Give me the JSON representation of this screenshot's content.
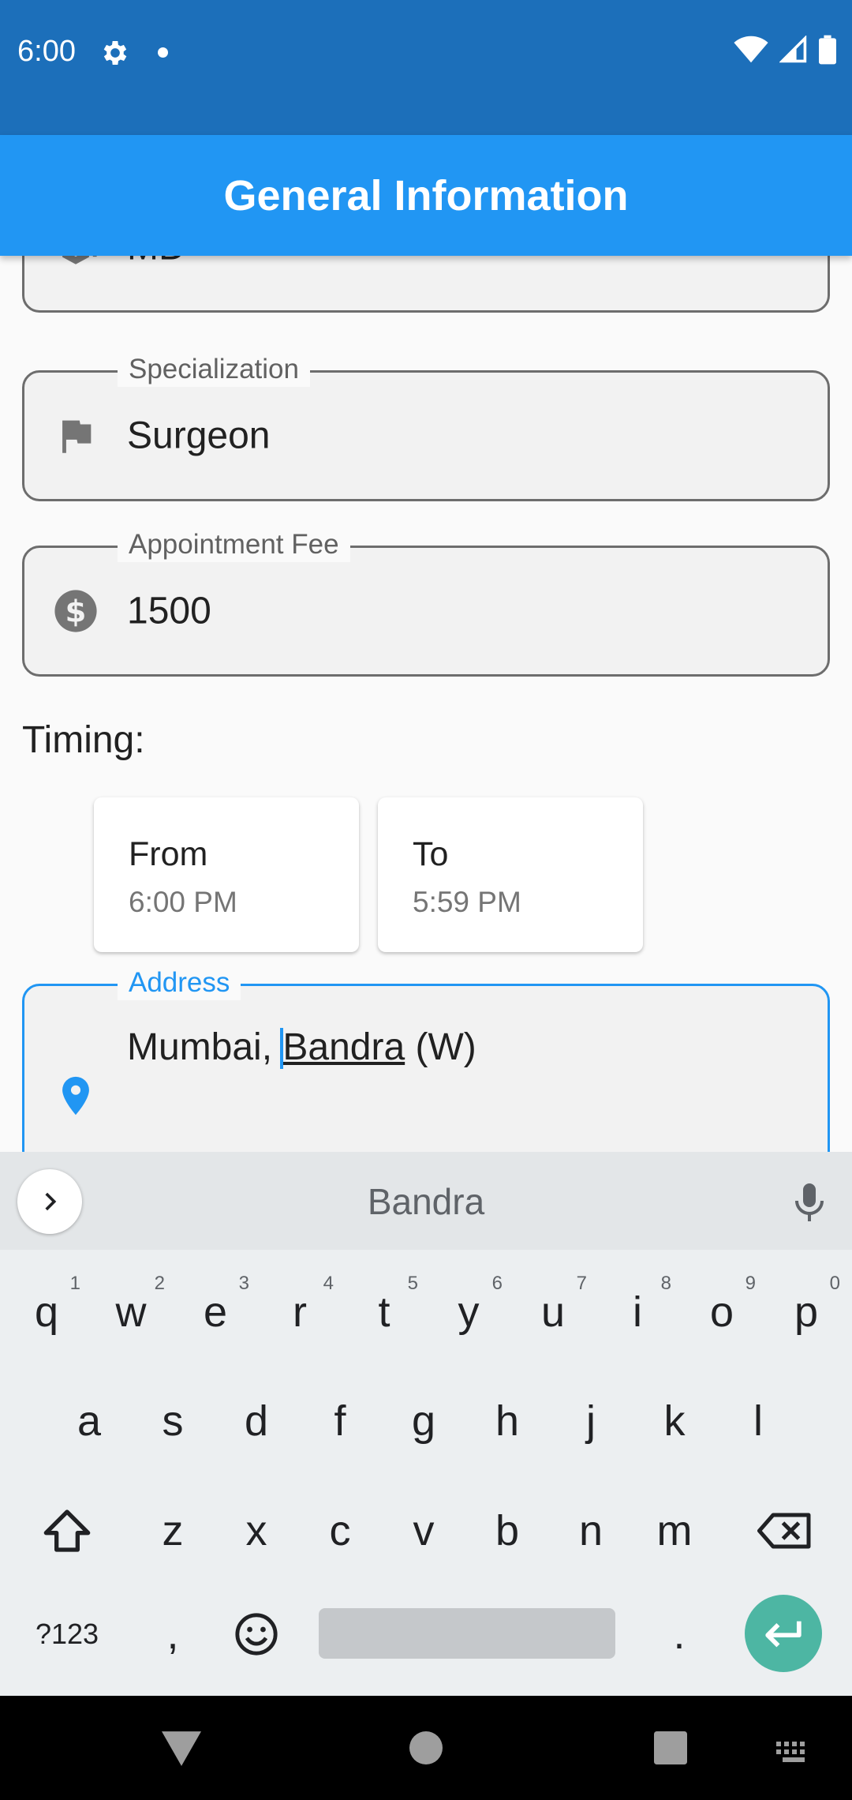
{
  "status_bar": {
    "time": "6:00"
  },
  "app_bar": {
    "title": "General Information"
  },
  "form": {
    "qualification": {
      "value": "MD"
    },
    "specialization": {
      "label": "Specialization",
      "value": "Surgeon"
    },
    "appointment_fee": {
      "label": "Appointment Fee",
      "value": "1500"
    },
    "timing_label": "Timing:",
    "timing": {
      "from": {
        "title": "From",
        "time": "6:00 PM"
      },
      "to": {
        "title": "To",
        "time": "5:59 PM"
      }
    },
    "address": {
      "label": "Address",
      "prefix": "Mumbai, ",
      "word": "Bandra",
      "suffix": " (W)"
    }
  },
  "keyboard": {
    "suggestion": "Bandra",
    "row1": [
      {
        "key": "q",
        "hint": "1"
      },
      {
        "key": "w",
        "hint": "2"
      },
      {
        "key": "e",
        "hint": "3"
      },
      {
        "key": "r",
        "hint": "4"
      },
      {
        "key": "t",
        "hint": "5"
      },
      {
        "key": "y",
        "hint": "6"
      },
      {
        "key": "u",
        "hint": "7"
      },
      {
        "key": "i",
        "hint": "8"
      },
      {
        "key": "o",
        "hint": "9"
      },
      {
        "key": "p",
        "hint": "0"
      }
    ],
    "row2": [
      "a",
      "s",
      "d",
      "f",
      "g",
      "h",
      "j",
      "k",
      "l"
    ],
    "row3": [
      "z",
      "x",
      "c",
      "v",
      "b",
      "n",
      "m"
    ],
    "row4": {
      "symbols": "?123",
      "comma": ",",
      "period": "."
    }
  },
  "colors": {
    "primary": "#2196f3",
    "status_bar": "#1c6fba",
    "accent": "#4db6a3"
  },
  "icons": [
    "settings-gear-icon",
    "wifi-icon",
    "signal-icon",
    "battery-icon",
    "school-icon",
    "flag-icon",
    "dollar-icon",
    "location-pin-icon",
    "chevron-right-icon",
    "mic-icon",
    "shift-icon",
    "backspace-icon",
    "emoji-icon",
    "enter-icon",
    "nav-back-icon",
    "nav-home-icon",
    "nav-recents-icon",
    "keyboard-switch-icon"
  ]
}
